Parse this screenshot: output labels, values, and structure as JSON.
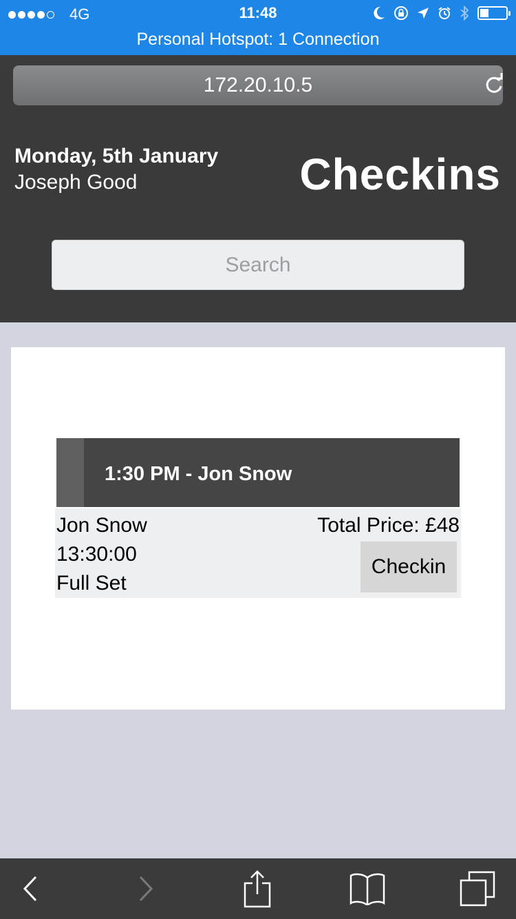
{
  "status_bar": {
    "carrier": "4G",
    "time": "11:48",
    "hotspot": "Personal Hotspot: 1 Connection"
  },
  "browser": {
    "url": "172.20.10.5"
  },
  "header": {
    "date": "Monday, 5th January",
    "user": "Joseph Good",
    "title": "Checkins"
  },
  "search": {
    "placeholder": "Search"
  },
  "appointment": {
    "heading": "1:30 PM - Jon Snow",
    "client": "Jon Snow",
    "time": "13:30:00",
    "service": "Full Set",
    "total_price": "Total Price: £48",
    "checkin_label": "Checkin"
  },
  "colors": {
    "status_bar": "#1e86e6",
    "header_bg": "#3a3a3a",
    "page_bg": "#d2d5de"
  }
}
